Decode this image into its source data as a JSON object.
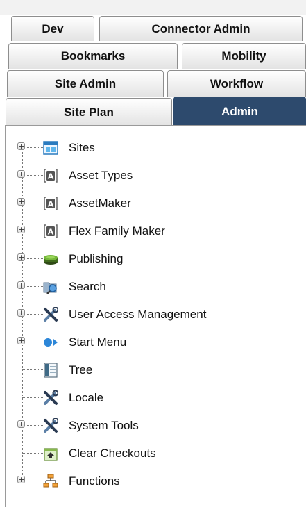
{
  "tabs": {
    "dev": "Dev",
    "connector_admin": "Connector Admin",
    "bookmarks": "Bookmarks",
    "mobility": "Mobility",
    "site_admin": "Site Admin",
    "workflow": "Workflow",
    "site_plan": "Site Plan",
    "admin": "Admin",
    "active": "Admin"
  },
  "tree": {
    "items": [
      {
        "label": "Sites",
        "icon": "sites-icon",
        "expandable": true
      },
      {
        "label": "Asset Types",
        "icon": "asset-a-icon",
        "expandable": true
      },
      {
        "label": "AssetMaker",
        "icon": "asset-a-icon",
        "expandable": true
      },
      {
        "label": "Flex Family Maker",
        "icon": "asset-a-icon",
        "expandable": true
      },
      {
        "label": "Publishing",
        "icon": "publishing-disk-icon",
        "expandable": true
      },
      {
        "label": "Search",
        "icon": "search-folder-icon",
        "expandable": true
      },
      {
        "label": "User Access Management",
        "icon": "tools-icon",
        "expandable": true
      },
      {
        "label": "Start Menu",
        "icon": "start-menu-icon",
        "expandable": true
      },
      {
        "label": "Tree",
        "icon": "tree-icon",
        "expandable": false
      },
      {
        "label": "Locale",
        "icon": "tools-icon",
        "expandable": false
      },
      {
        "label": "System Tools",
        "icon": "tools-icon",
        "expandable": true
      },
      {
        "label": "Clear Checkouts",
        "icon": "clear-checkouts-icon",
        "expandable": false
      },
      {
        "label": "Functions",
        "icon": "functions-icon",
        "expandable": true
      }
    ]
  },
  "colors": {
    "active_tab": "#2d4a6d",
    "tab_border": "#8e8e8e"
  }
}
